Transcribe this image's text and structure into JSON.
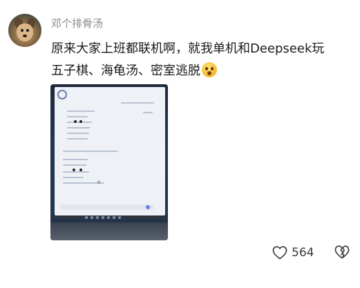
{
  "post": {
    "username": "邓个排骨汤",
    "text_line1": "原来大家上班都联机啊，就我单机和Deepseek玩",
    "text_line2": "五子棋、海龟汤、密室逃脱",
    "emoji": "zany-face-emoji",
    "image": "photo-of-monitor-screen",
    "likes": "564"
  },
  "icons": {
    "like": "heart-icon",
    "dislike": "broken-heart-icon"
  },
  "colors": {
    "username": "#8a8a8a",
    "text": "#1a1a1a",
    "count": "#3a3a3a"
  }
}
